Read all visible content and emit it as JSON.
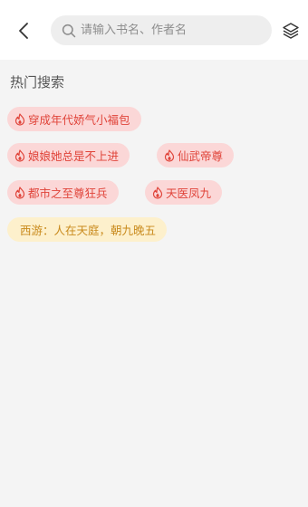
{
  "header": {
    "search_placeholder": "请输入书名、作者名"
  },
  "hot_search": {
    "title": "热门搜索",
    "tags": [
      {
        "label": "穿成年代娇气小福包",
        "hot": true
      },
      {
        "label": "娘娘她总是不上进",
        "hot": true
      },
      {
        "label": "仙武帝尊",
        "hot": true
      },
      {
        "label": "都市之至尊狂兵",
        "hot": true
      },
      {
        "label": "天医凤九",
        "hot": true
      },
      {
        "label": "西游：人在天庭，朝九晚五",
        "hot": false
      }
    ]
  },
  "colors": {
    "hot_tag_bg": "#fbd7d7",
    "hot_tag_text": "#e0443a",
    "plain_tag_bg": "#fdf0cc",
    "plain_tag_text": "#c98a1c"
  }
}
